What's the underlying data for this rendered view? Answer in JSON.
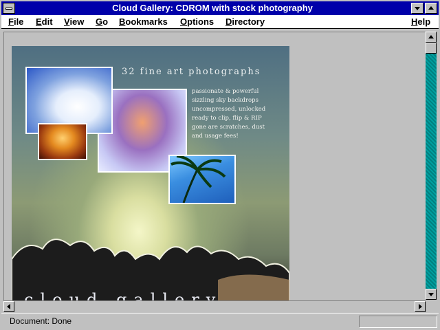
{
  "window": {
    "title": "Cloud Gallery: CDROM with stock photography"
  },
  "menu": {
    "items": [
      {
        "label": "File",
        "mnemonic": "F",
        "rest": "ile"
      },
      {
        "label": "Edit",
        "mnemonic": "E",
        "rest": "dit"
      },
      {
        "label": "View",
        "mnemonic": "V",
        "rest": "iew"
      },
      {
        "label": "Go",
        "mnemonic": "G",
        "rest": "o"
      },
      {
        "label": "Bookmarks",
        "mnemonic": "B",
        "rest": "ookmarks"
      },
      {
        "label": "Options",
        "mnemonic": "O",
        "rest": "ptions"
      },
      {
        "label": "Directory",
        "mnemonic": "D",
        "rest": "irectory"
      },
      {
        "label": "Help",
        "mnemonic": "H",
        "rest": "elp"
      }
    ]
  },
  "poster": {
    "heading": "32 fine art photographs",
    "blurb": [
      "passionate & powerful",
      "sizzling sky backdrops",
      "uncompressed, unlocked",
      "ready to clip, flip & RIP",
      "gone are scratches, dust",
      "and usage fees!"
    ],
    "title": "cloud gallery"
  },
  "status": {
    "text": "Document: Done"
  },
  "colors": {
    "titlebar": "#0000aa",
    "chrome": "#c0c0c0",
    "scroll_track": "#008080"
  }
}
